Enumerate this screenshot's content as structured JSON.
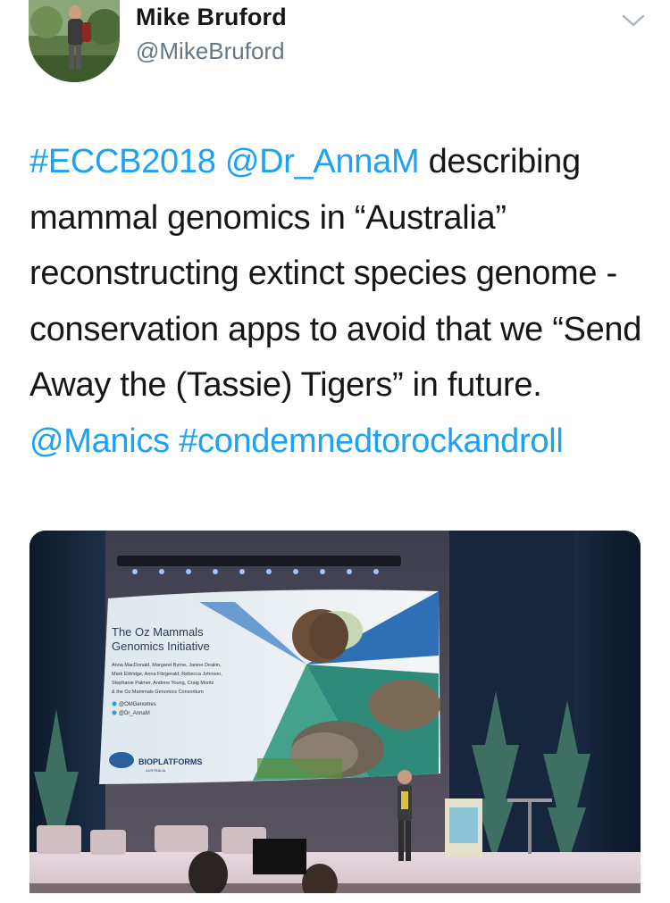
{
  "author": {
    "name": "Mike Bruford",
    "handle": "@MikeBruford"
  },
  "tweet": {
    "hashtag1": "#ECCB2018",
    "mention1": "@Dr_AnnaM",
    "text1": " describing mammal genomics in “Australia” reconstructing extinct species genome - conservation apps to avoid that we “Send Away the (Tassie) Tigers” in future. ",
    "mention2": "@Manics",
    "hashtag2": "#condemnedtorockandroll"
  },
  "slide": {
    "title_line1": "The Oz Mammals",
    "title_line2": "Genomics Initiative",
    "authors": [
      "Anna MacDonald, Margaret Byrne, Janine Deakin,",
      "Mark Eldridge, Anna Fitzgerald, Rebecca Johnson,",
      "Stephanie Palmer, Andrew Young, Craig Moritz",
      "& the Oz Mammals Genomics Consortium"
    ],
    "twitter1": "@OMGenomes",
    "twitter2": "@Dr_AnnaM",
    "logo_main": "BIOPLATFORMS",
    "logo_sub": "AUSTRALIA"
  },
  "icons": {
    "menu": "chevron-down-icon",
    "bird": "twitter-bird-icon"
  },
  "colors": {
    "link": "#1da1f2",
    "text": "#14171a",
    "muted": "#657786"
  }
}
